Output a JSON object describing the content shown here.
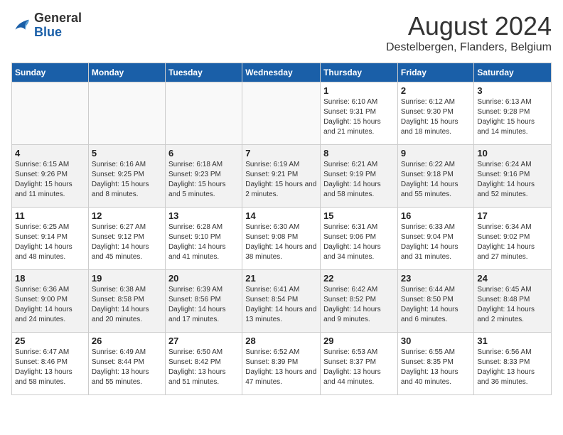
{
  "header": {
    "logo_general": "General",
    "logo_blue": "Blue",
    "month_title": "August 2024",
    "location": "Destelbergen, Flanders, Belgium"
  },
  "days_of_week": [
    "Sunday",
    "Monday",
    "Tuesday",
    "Wednesday",
    "Thursday",
    "Friday",
    "Saturday"
  ],
  "weeks": [
    [
      {
        "day": "",
        "info": ""
      },
      {
        "day": "",
        "info": ""
      },
      {
        "day": "",
        "info": ""
      },
      {
        "day": "",
        "info": ""
      },
      {
        "day": "1",
        "info": "Sunrise: 6:10 AM\nSunset: 9:31 PM\nDaylight: 15 hours and 21 minutes."
      },
      {
        "day": "2",
        "info": "Sunrise: 6:12 AM\nSunset: 9:30 PM\nDaylight: 15 hours and 18 minutes."
      },
      {
        "day": "3",
        "info": "Sunrise: 6:13 AM\nSunset: 9:28 PM\nDaylight: 15 hours and 14 minutes."
      }
    ],
    [
      {
        "day": "4",
        "info": "Sunrise: 6:15 AM\nSunset: 9:26 PM\nDaylight: 15 hours and 11 minutes."
      },
      {
        "day": "5",
        "info": "Sunrise: 6:16 AM\nSunset: 9:25 PM\nDaylight: 15 hours and 8 minutes."
      },
      {
        "day": "6",
        "info": "Sunrise: 6:18 AM\nSunset: 9:23 PM\nDaylight: 15 hours and 5 minutes."
      },
      {
        "day": "7",
        "info": "Sunrise: 6:19 AM\nSunset: 9:21 PM\nDaylight: 15 hours and 2 minutes."
      },
      {
        "day": "8",
        "info": "Sunrise: 6:21 AM\nSunset: 9:19 PM\nDaylight: 14 hours and 58 minutes."
      },
      {
        "day": "9",
        "info": "Sunrise: 6:22 AM\nSunset: 9:18 PM\nDaylight: 14 hours and 55 minutes."
      },
      {
        "day": "10",
        "info": "Sunrise: 6:24 AM\nSunset: 9:16 PM\nDaylight: 14 hours and 52 minutes."
      }
    ],
    [
      {
        "day": "11",
        "info": "Sunrise: 6:25 AM\nSunset: 9:14 PM\nDaylight: 14 hours and 48 minutes."
      },
      {
        "day": "12",
        "info": "Sunrise: 6:27 AM\nSunset: 9:12 PM\nDaylight: 14 hours and 45 minutes."
      },
      {
        "day": "13",
        "info": "Sunrise: 6:28 AM\nSunset: 9:10 PM\nDaylight: 14 hours and 41 minutes."
      },
      {
        "day": "14",
        "info": "Sunrise: 6:30 AM\nSunset: 9:08 PM\nDaylight: 14 hours and 38 minutes."
      },
      {
        "day": "15",
        "info": "Sunrise: 6:31 AM\nSunset: 9:06 PM\nDaylight: 14 hours and 34 minutes."
      },
      {
        "day": "16",
        "info": "Sunrise: 6:33 AM\nSunset: 9:04 PM\nDaylight: 14 hours and 31 minutes."
      },
      {
        "day": "17",
        "info": "Sunrise: 6:34 AM\nSunset: 9:02 PM\nDaylight: 14 hours and 27 minutes."
      }
    ],
    [
      {
        "day": "18",
        "info": "Sunrise: 6:36 AM\nSunset: 9:00 PM\nDaylight: 14 hours and 24 minutes."
      },
      {
        "day": "19",
        "info": "Sunrise: 6:38 AM\nSunset: 8:58 PM\nDaylight: 14 hours and 20 minutes."
      },
      {
        "day": "20",
        "info": "Sunrise: 6:39 AM\nSunset: 8:56 PM\nDaylight: 14 hours and 17 minutes."
      },
      {
        "day": "21",
        "info": "Sunrise: 6:41 AM\nSunset: 8:54 PM\nDaylight: 14 hours and 13 minutes."
      },
      {
        "day": "22",
        "info": "Sunrise: 6:42 AM\nSunset: 8:52 PM\nDaylight: 14 hours and 9 minutes."
      },
      {
        "day": "23",
        "info": "Sunrise: 6:44 AM\nSunset: 8:50 PM\nDaylight: 14 hours and 6 minutes."
      },
      {
        "day": "24",
        "info": "Sunrise: 6:45 AM\nSunset: 8:48 PM\nDaylight: 14 hours and 2 minutes."
      }
    ],
    [
      {
        "day": "25",
        "info": "Sunrise: 6:47 AM\nSunset: 8:46 PM\nDaylight: 13 hours and 58 minutes."
      },
      {
        "day": "26",
        "info": "Sunrise: 6:49 AM\nSunset: 8:44 PM\nDaylight: 13 hours and 55 minutes."
      },
      {
        "day": "27",
        "info": "Sunrise: 6:50 AM\nSunset: 8:42 PM\nDaylight: 13 hours and 51 minutes."
      },
      {
        "day": "28",
        "info": "Sunrise: 6:52 AM\nSunset: 8:39 PM\nDaylight: 13 hours and 47 minutes."
      },
      {
        "day": "29",
        "info": "Sunrise: 6:53 AM\nSunset: 8:37 PM\nDaylight: 13 hours and 44 minutes."
      },
      {
        "day": "30",
        "info": "Sunrise: 6:55 AM\nSunset: 8:35 PM\nDaylight: 13 hours and 40 minutes."
      },
      {
        "day": "31",
        "info": "Sunrise: 6:56 AM\nSunset: 8:33 PM\nDaylight: 13 hours and 36 minutes."
      }
    ]
  ]
}
